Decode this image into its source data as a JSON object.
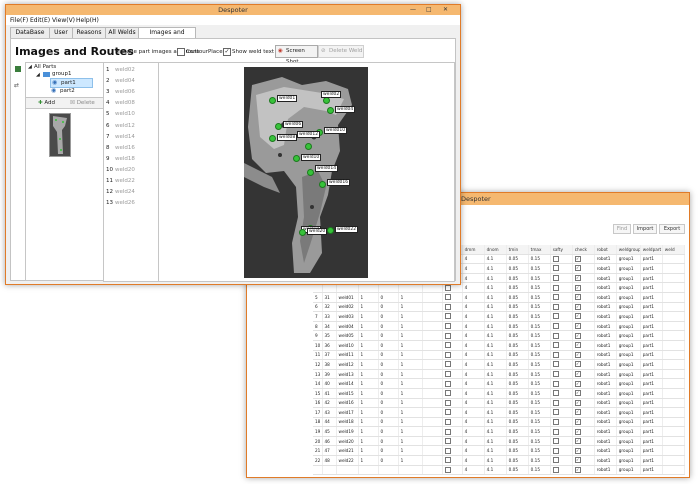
{
  "back_window": {
    "title": "Despoter",
    "buttons": [
      "Find",
      "Import",
      "Export"
    ],
    "columns": [
      "",
      "",
      "",
      "",
      "",
      "",
      "",
      "",
      "dmm",
      "dnom",
      "tmin",
      "tmax",
      "safty",
      "check",
      "robot",
      "weldgroup",
      "weldpart",
      "weld"
    ],
    "rows": [
      [
        "",
        "",
        "",
        "",
        "",
        "",
        "",
        "",
        "4",
        "4.1",
        "0.05",
        "0.15",
        "",
        "",
        "robot1",
        "group1",
        "part1",
        ""
      ],
      [
        "",
        "",
        "",
        "",
        "",
        "",
        "",
        "",
        "4",
        "4.1",
        "0.05",
        "0.15",
        "",
        "",
        "robot1",
        "group1",
        "part1",
        ""
      ],
      [
        "",
        "",
        "",
        "",
        "",
        "",
        "",
        "",
        "4",
        "4.1",
        "0.05",
        "0.15",
        "",
        "",
        "robot1",
        "group1",
        "part1",
        ""
      ],
      [
        "",
        "",
        "",
        "",
        "",
        "",
        "",
        "",
        "4",
        "4.1",
        "0.05",
        "0.15",
        "",
        "",
        "robot1",
        "group1",
        "part1",
        ""
      ],
      [
        "5",
        "31",
        "weld01",
        "1",
        "0",
        "1",
        "",
        "",
        "4",
        "4.1",
        "0.05",
        "0.15",
        "",
        "",
        "robot1",
        "group1",
        "part1",
        ""
      ],
      [
        "6",
        "32",
        "weld02",
        "1",
        "0",
        "1",
        "",
        "",
        "4",
        "4.1",
        "0.05",
        "0.15",
        "",
        "",
        "robot1",
        "group1",
        "part1",
        ""
      ],
      [
        "7",
        "33",
        "weld03",
        "1",
        "0",
        "1",
        "",
        "",
        "4",
        "4.1",
        "0.05",
        "0.15",
        "",
        "",
        "robot1",
        "group1",
        "part1",
        ""
      ],
      [
        "8",
        "34",
        "weld04",
        "1",
        "0",
        "1",
        "",
        "",
        "4",
        "4.1",
        "0.05",
        "0.15",
        "",
        "",
        "robot1",
        "group1",
        "part1",
        ""
      ],
      [
        "9",
        "35",
        "weld05",
        "1",
        "0",
        "1",
        "",
        "",
        "4",
        "4.1",
        "0.05",
        "0.15",
        "",
        "",
        "robot1",
        "group1",
        "part1",
        ""
      ],
      [
        "10",
        "36",
        "weld10",
        "1",
        "0",
        "1",
        "",
        "",
        "4",
        "4.1",
        "0.05",
        "0.15",
        "",
        "",
        "robot1",
        "group1",
        "part1",
        ""
      ],
      [
        "11",
        "37",
        "weld11",
        "1",
        "0",
        "1",
        "",
        "",
        "4",
        "4.1",
        "0.05",
        "0.15",
        "",
        "",
        "robot1",
        "group1",
        "part1",
        ""
      ],
      [
        "12",
        "38",
        "weld12",
        "1",
        "0",
        "1",
        "",
        "",
        "4",
        "4.1",
        "0.05",
        "0.15",
        "",
        "",
        "robot1",
        "group1",
        "part1",
        ""
      ],
      [
        "13",
        "39",
        "weld13",
        "1",
        "0",
        "1",
        "",
        "",
        "4",
        "4.1",
        "0.05",
        "0.15",
        "",
        "",
        "robot1",
        "group1",
        "part1",
        ""
      ],
      [
        "14",
        "40",
        "weld14",
        "1",
        "0",
        "1",
        "",
        "",
        "4",
        "4.1",
        "0.05",
        "0.15",
        "",
        "",
        "robot1",
        "group1",
        "part1",
        ""
      ],
      [
        "15",
        "41",
        "weld15",
        "1",
        "0",
        "1",
        "",
        "",
        "4",
        "4.1",
        "0.05",
        "0.15",
        "",
        "",
        "robot1",
        "group1",
        "part1",
        ""
      ],
      [
        "16",
        "42",
        "weld16",
        "1",
        "0",
        "1",
        "",
        "",
        "4",
        "4.1",
        "0.05",
        "0.15",
        "",
        "",
        "robot1",
        "group1",
        "part1",
        ""
      ],
      [
        "17",
        "43",
        "weld17",
        "1",
        "0",
        "1",
        "",
        "",
        "4",
        "4.1",
        "0.05",
        "0.15",
        "",
        "",
        "robot1",
        "group1",
        "part1",
        ""
      ],
      [
        "18",
        "44",
        "weld18",
        "1",
        "0",
        "1",
        "",
        "",
        "4",
        "4.1",
        "0.05",
        "0.15",
        "",
        "",
        "robot1",
        "group1",
        "part1",
        ""
      ],
      [
        "19",
        "45",
        "weld19",
        "1",
        "0",
        "1",
        "",
        "",
        "4",
        "4.1",
        "0.05",
        "0.15",
        "",
        "",
        "robot1",
        "group1",
        "part1",
        ""
      ],
      [
        "20",
        "46",
        "weld20",
        "1",
        "0",
        "1",
        "",
        "",
        "4",
        "4.1",
        "0.05",
        "0.15",
        "",
        "",
        "robot1",
        "group1",
        "part1",
        ""
      ],
      [
        "21",
        "47",
        "weld21",
        "1",
        "0",
        "1",
        "",
        "",
        "4",
        "4.1",
        "0.05",
        "0.15",
        "",
        "",
        "robot1",
        "group1",
        "part1",
        ""
      ],
      [
        "22",
        "48",
        "weld22",
        "1",
        "0",
        "1",
        "",
        "",
        "4",
        "4.1",
        "0.05",
        "0.15",
        "",
        "",
        "robot1",
        "group1",
        "part1",
        ""
      ],
      [
        "",
        "",
        "",
        "",
        "",
        "",
        "",
        "",
        "4",
        "4.1",
        "0.05",
        "0.15",
        "",
        "",
        "robot1",
        "group1",
        "part1",
        ""
      ]
    ]
  },
  "main_window": {
    "title": "Despoter",
    "menu": [
      "File(F)",
      "Edit(E)",
      "View(V)",
      "Help(H)"
    ],
    "tabs": [
      "DataBase",
      "User",
      "Reasons",
      "All Welds",
      "Images and Routes"
    ],
    "active_tab": "Images and Routes",
    "page": {
      "heading": "Images and Routes",
      "subtitle": "Manage part images and routs",
      "contour_label": "ContourPlace",
      "show_weld_label": "Show weld text",
      "screenshot_button": "Screen Shot",
      "delete_weld_button": "Delete Weld"
    },
    "tree": {
      "root": "All Parts",
      "group": "group1",
      "parts": [
        "part1",
        "part2"
      ],
      "selected": "part1"
    },
    "tree_buttons": {
      "add": "Add",
      "delete": "Delete"
    },
    "weld_list": [
      [
        "1",
        "weld02"
      ],
      [
        "2",
        "weld04"
      ],
      [
        "3",
        "weld06"
      ],
      [
        "4",
        "weld08"
      ],
      [
        "5",
        "weld10"
      ],
      [
        "6",
        "weld12"
      ],
      [
        "7",
        "weld14"
      ],
      [
        "8",
        "weld16"
      ],
      [
        "9",
        "weld18"
      ],
      [
        "10",
        "weld20"
      ],
      [
        "11",
        "weld22"
      ],
      [
        "12",
        "weld24"
      ],
      [
        "13",
        "weld26"
      ]
    ],
    "weld_labels": [
      "weld01",
      "weld02",
      "weld04",
      "weld06",
      "weld08",
      "weld010",
      "weld012",
      "weld10",
      "weld014",
      "weld016",
      "weld18",
      "weld20",
      "weld022"
    ]
  },
  "colors": {
    "title_bar": "#f5b870",
    "window_border": "#e07b28",
    "weld_dot": "#37c23a",
    "selection": "#cde8ff"
  }
}
